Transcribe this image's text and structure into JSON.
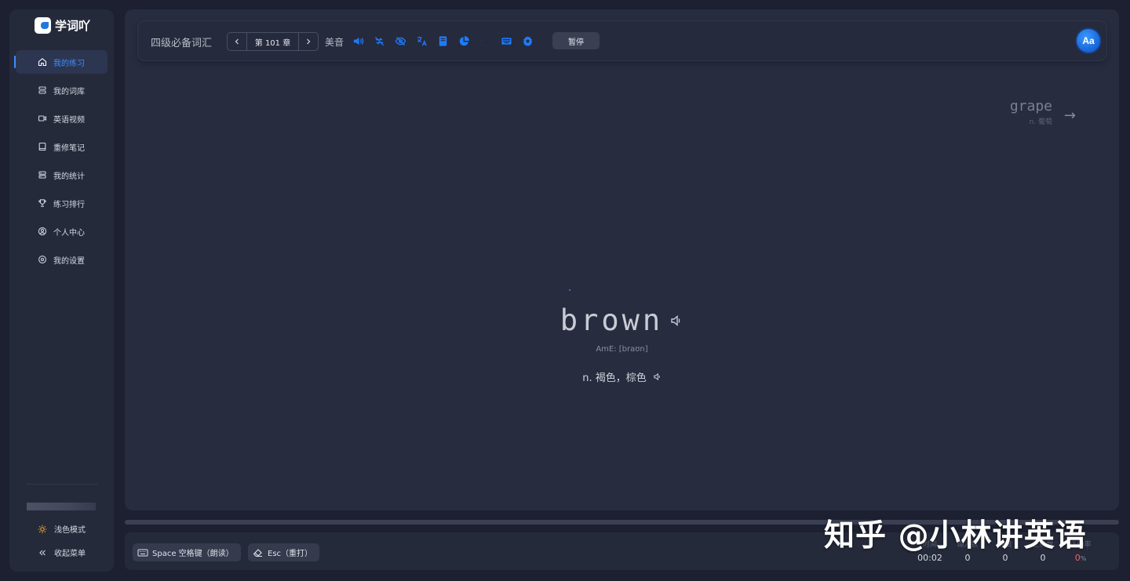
{
  "app": {
    "name": "学词吖"
  },
  "sidebar": {
    "items": [
      {
        "label": "我的练习",
        "icon": "home-icon",
        "active": true
      },
      {
        "label": "我的词库",
        "icon": "database-icon",
        "active": false
      },
      {
        "label": "英语视频",
        "icon": "video-icon",
        "active": false
      },
      {
        "label": "重修笔记",
        "icon": "book-icon",
        "active": false
      },
      {
        "label": "我的统计",
        "icon": "server-icon",
        "active": false
      },
      {
        "label": "练习排行",
        "icon": "trophy-icon",
        "active": false
      },
      {
        "label": "个人中心",
        "icon": "user-circle-icon",
        "active": false
      },
      {
        "label": "我的设置",
        "icon": "settings-icon",
        "active": false
      }
    ],
    "theme_label": "浅色模式",
    "collapse_label": "收起菜单"
  },
  "toolbar": {
    "dictionary": "四级必备词汇",
    "chapter_label": "第 101 章",
    "accent": "美音",
    "pause_label": "暂停",
    "avatar_label": "Aa",
    "accent_color": "#1e7bff"
  },
  "practice": {
    "word": "brown",
    "phonetic": "AmE: [braʊn]",
    "translation": "n. 褐色，棕色",
    "next_word": "grape",
    "next_translation": "n. 葡萄",
    "progress": 0
  },
  "bottom": {
    "space_hint": "Space 空格键（朗读）",
    "esc_hint": "Esc（重打）",
    "stats": [
      {
        "label": "时间",
        "value": "00:02"
      },
      {
        "label": "输入数",
        "value": "0"
      },
      {
        "label": "速度",
        "value": "0"
      },
      {
        "label": "正确数",
        "value": "0"
      },
      {
        "label": "正确率",
        "value": "0",
        "unit": "%"
      }
    ]
  },
  "watermark": "知乎 @小林讲英语"
}
